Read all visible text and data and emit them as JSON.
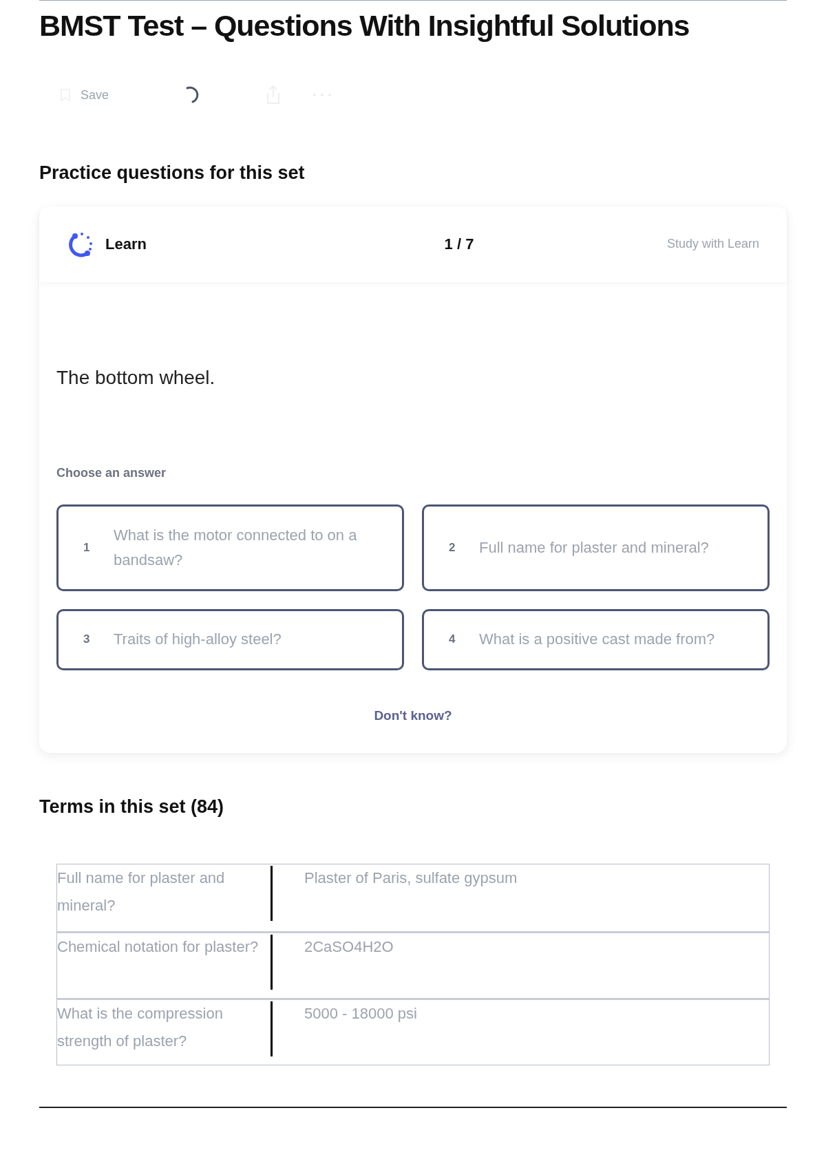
{
  "title": "BMST Test – Questions With Insightful Solutions",
  "toolbar": {
    "save_label": "Save"
  },
  "practice": {
    "heading": "Practice questions for this set",
    "mode": "Learn",
    "progress": "1 / 7",
    "study_link": "Study with Learn",
    "question": "The bottom wheel.",
    "prompt": "Choose an answer",
    "answers": [
      {
        "number": "1",
        "text": "What is the motor connected to on a bandsaw?"
      },
      {
        "number": "2",
        "text": "Full name for plaster and mineral?"
      },
      {
        "number": "3",
        "text": "Traits of high-alloy steel?"
      },
      {
        "number": "4",
        "text": "What is a positive cast made from?"
      }
    ],
    "dont_know": "Don't know?"
  },
  "terms": {
    "heading": "Terms in this set (84)",
    "rows": [
      {
        "term": "Full name for plaster and mineral?",
        "definition": "Plaster of Paris, sulfate gypsum"
      },
      {
        "term": "Chemical notation for plaster?",
        "definition": "2CaSO4H2O"
      },
      {
        "term": "What is the compression strength of plaster?",
        "definition": "5000 - 18000 psi"
      }
    ]
  }
}
